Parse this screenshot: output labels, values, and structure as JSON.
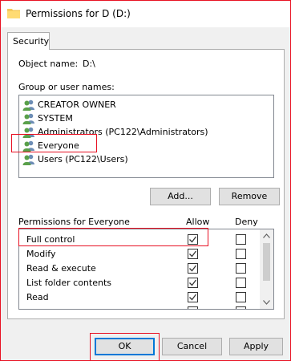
{
  "window": {
    "title": "Permissions for D (D:)"
  },
  "tabs": [
    {
      "label": "Security"
    }
  ],
  "object": {
    "label": "Object name:",
    "value": "D:\\"
  },
  "groups": {
    "label": "Group or user names:",
    "items": [
      {
        "name": "CREATOR OWNER"
      },
      {
        "name": "SYSTEM"
      },
      {
        "name": "Administrators (PC122\\Administrators)"
      },
      {
        "name": "Everyone"
      },
      {
        "name": "Users (PC122\\Users)"
      }
    ],
    "selected": "Everyone"
  },
  "buttons": {
    "add": "Add...",
    "remove": "Remove",
    "ok": "OK",
    "cancel": "Cancel",
    "apply": "Apply"
  },
  "permissions": {
    "label": "Permissions for Everyone",
    "allow_header": "Allow",
    "deny_header": "Deny",
    "rows": [
      {
        "name": "Full control",
        "allow": true,
        "deny": false
      },
      {
        "name": "Modify",
        "allow": true,
        "deny": false
      },
      {
        "name": "Read & execute",
        "allow": true,
        "deny": false
      },
      {
        "name": "List folder contents",
        "allow": true,
        "deny": false
      },
      {
        "name": "Read",
        "allow": true,
        "deny": false
      }
    ]
  },
  "colors": {
    "highlight": "#e81123",
    "accent": "#0078d7"
  },
  "icons": {
    "title": "folder-icon",
    "user": "users-group-icon"
  }
}
